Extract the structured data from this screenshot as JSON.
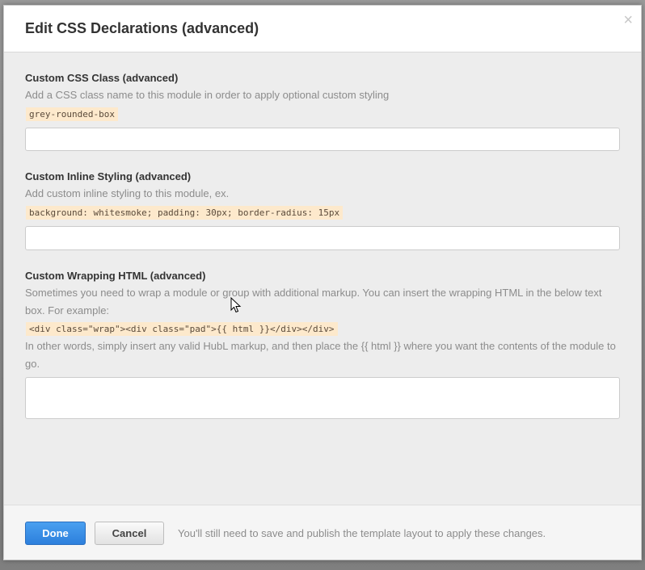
{
  "modal": {
    "title": "Edit CSS Declarations (advanced)",
    "close_glyph": "×"
  },
  "css_class": {
    "label": "Custom CSS Class (advanced)",
    "help": "Add a CSS class name to this module in order to apply optional custom styling",
    "example": "grey-rounded-box",
    "value": ""
  },
  "inline_styling": {
    "label": "Custom Inline Styling (advanced)",
    "help": "Add custom inline styling to this module, ex.",
    "example": "background: whitesmoke; padding: 30px; border-radius: 15px",
    "value": ""
  },
  "wrapping_html": {
    "label": "Custom Wrapping HTML (advanced)",
    "help": "Sometimes you need to wrap a module or group with additional markup. You can insert the wrapping HTML in the below text box. For example:",
    "example": "<div class=\"wrap\"><div class=\"pad\">{{ html }}</div></div>",
    "help_after": "In other words, simply insert any valid HubL markup, and then place the {{ html }} where you want the contents of the module to go.",
    "value": ""
  },
  "footer": {
    "done_label": "Done",
    "cancel_label": "Cancel",
    "note": "You'll still need to save and publish the template layout to apply these changes."
  },
  "colors": {
    "primary_button": "#2c7fdc",
    "code_highlight": "#fde9cc"
  }
}
